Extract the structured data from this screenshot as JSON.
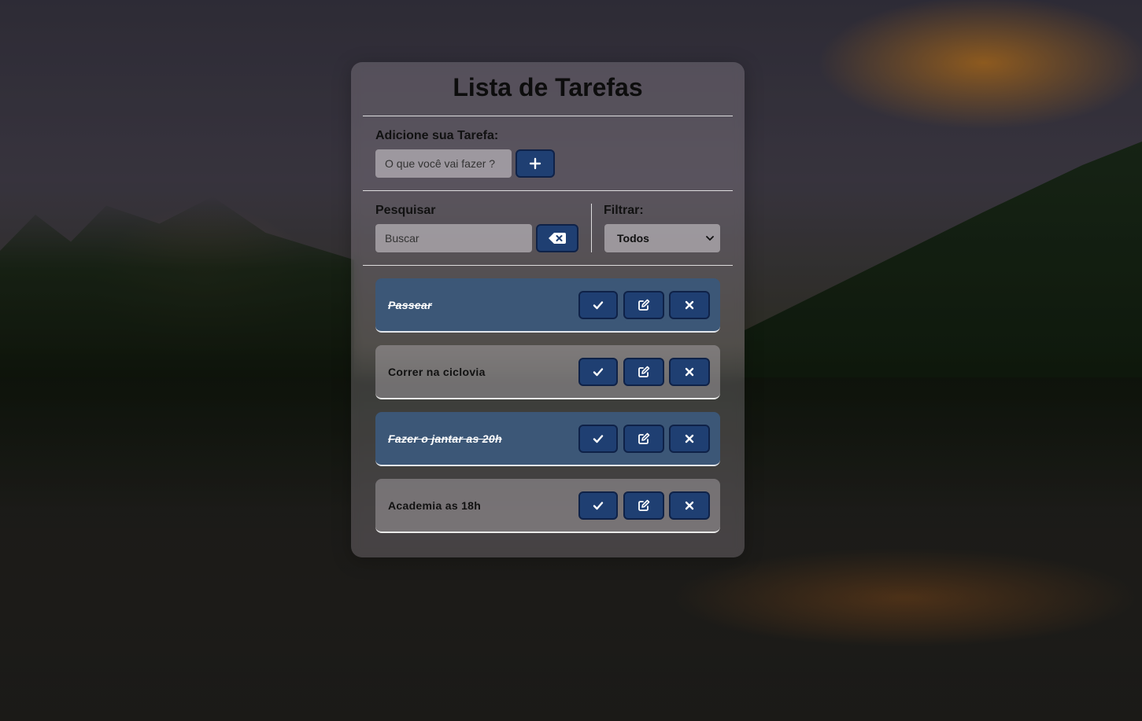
{
  "app": {
    "title": "Lista de Tarefas"
  },
  "add_section": {
    "label": "Adicione sua Tarefa:",
    "placeholder": "O que você vai fazer ?",
    "value": "",
    "add_button_icon": "plus-icon"
  },
  "search_section": {
    "label": "Pesquisar",
    "placeholder": "Buscar",
    "value": "",
    "clear_button_icon": "backspace-icon"
  },
  "filter_section": {
    "label": "Filtrar:",
    "selected": "Todos"
  },
  "tasks": [
    {
      "text": "Passear",
      "done": true
    },
    {
      "text": "Correr na ciclovia",
      "done": false
    },
    {
      "text": "Fazer o jantar as 20h",
      "done": true
    },
    {
      "text": "Academia as 18h",
      "done": false
    }
  ],
  "task_action_icons": [
    "check-icon",
    "edit-icon",
    "close-icon"
  ],
  "colors": {
    "button_bg": "#1f3f72",
    "done_task_bg": "#3c5777"
  }
}
